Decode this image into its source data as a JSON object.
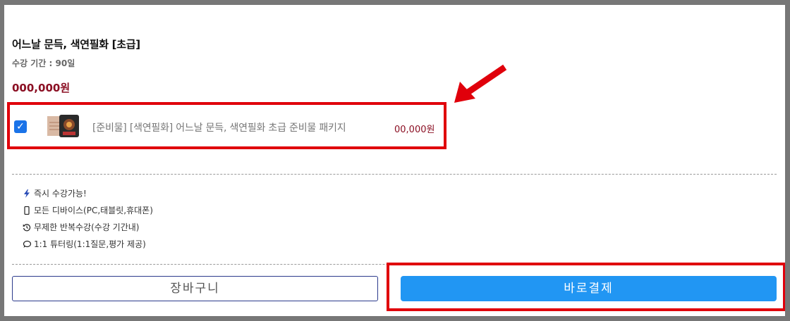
{
  "course": {
    "title": "어느날 문득, 색연필화 [초급]",
    "period": "수강 기간 : 90일",
    "price": "000,000원"
  },
  "package": {
    "name": "[준비물] [색연필화] 어느날 문득, 색연필화 초급 준비물 패키지",
    "price": "00,000원",
    "checked": true
  },
  "features": [
    {
      "icon": "lightning-icon",
      "label": "즉시 수강가능!"
    },
    {
      "icon": "mobile-icon",
      "label": "모든 디바이스(PC,태블릿,휴대폰)"
    },
    {
      "icon": "history-icon",
      "label": "무제한 반복수강(수강 기간내)"
    },
    {
      "icon": "chat-icon",
      "label": "1:1 튜터링(1:1질문,평가 제공)"
    }
  ],
  "buttons": {
    "cart": "장바구니",
    "buy": "바로결제"
  },
  "colors": {
    "highlight": "#e0000b",
    "price": "#8b0f23",
    "primary": "#2196f3"
  }
}
